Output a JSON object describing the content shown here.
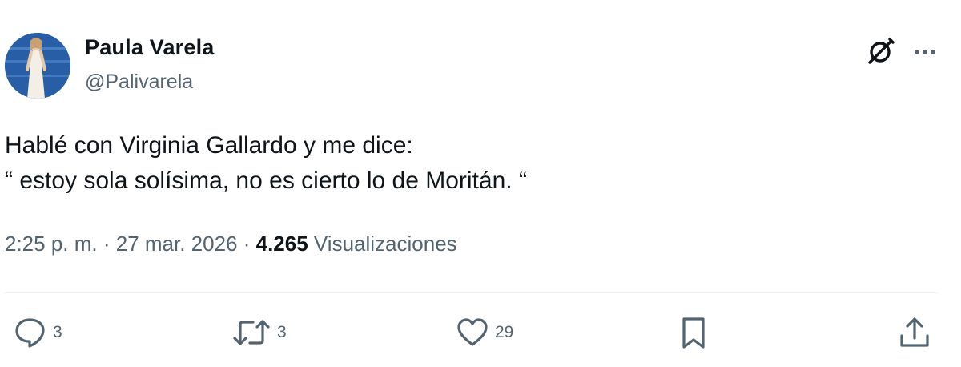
{
  "author": {
    "name": "Paula Varela",
    "handle": "@Palivarela"
  },
  "tweet": {
    "lines": [
      "Hablé con Virginia Gallardo y me dice:",
      "“ estoy sola solísima, no es cierto lo de Moritán. “"
    ]
  },
  "meta": {
    "time": "2:25 p. m.",
    "separator": " · ",
    "date": "27 mar. 2026",
    "views_count": "4.265",
    "views_label": " Visualizaciones"
  },
  "actions": {
    "reply_count": "3",
    "retweet_count": "3",
    "like_count": "29"
  },
  "icons": {
    "header_right": [
      "grok-icon",
      "more-icon"
    ],
    "actions": [
      "reply-icon",
      "retweet-icon",
      "like-icon",
      "bookmark-icon",
      "share-icon"
    ]
  },
  "colors": {
    "text": "#0f1419",
    "secondary": "#536471",
    "divider": "#eff3f4"
  }
}
